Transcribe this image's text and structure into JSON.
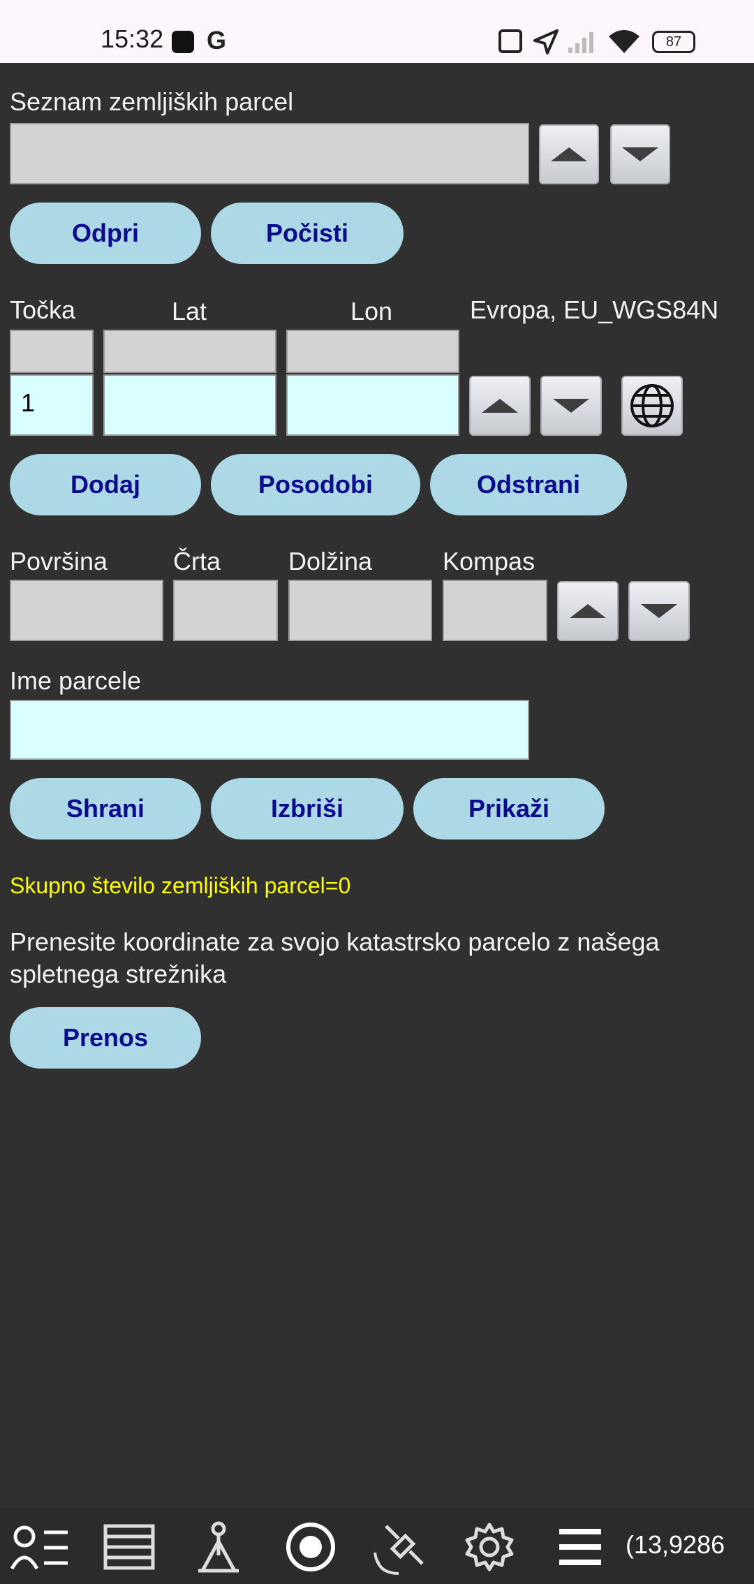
{
  "status": {
    "time": "15:32",
    "battery": "87"
  },
  "parcels_section": {
    "title": "Seznam zemljiških parcel",
    "open_label": "Odpri",
    "clear_label": "Počisti"
  },
  "point_section": {
    "point_header": "Točka",
    "lat_header": "Lat",
    "lon_header": "Lon",
    "datum": "Evropa, EU_WGS84N",
    "point_value": "1",
    "add_label": "Dodaj",
    "update_label": "Posodobi",
    "remove_label": "Odstrani"
  },
  "measure_section": {
    "area_label": "Površina",
    "line_label": "Črta",
    "length_label": "Dolžina",
    "compass_label": "Kompas"
  },
  "name_section": {
    "title": "Ime parcele",
    "save_label": "Shrani",
    "delete_label": "Izbriši",
    "show_label": "Prikaži"
  },
  "info": {
    "total": "Skupno število zemljiških parcel=0",
    "download_text": "Prenesite koordinate za svojo katastrsko parcelo z našega spletnega strežnika",
    "download_label": "Prenos"
  },
  "navbar": {
    "coords": "(13,9286",
    "icons": [
      "user-list-icon",
      "list-icon",
      "survey-point-icon",
      "record-icon",
      "satellite-icon",
      "gear-icon",
      "menu-icon"
    ]
  },
  "colors": {
    "background": "#303030",
    "pill": "#add8e6",
    "pill_text": "#0b0b8c",
    "input_gray": "#d3d3d3",
    "input_cyan": "#d9ffff",
    "highlight_text": "#ffff00"
  }
}
